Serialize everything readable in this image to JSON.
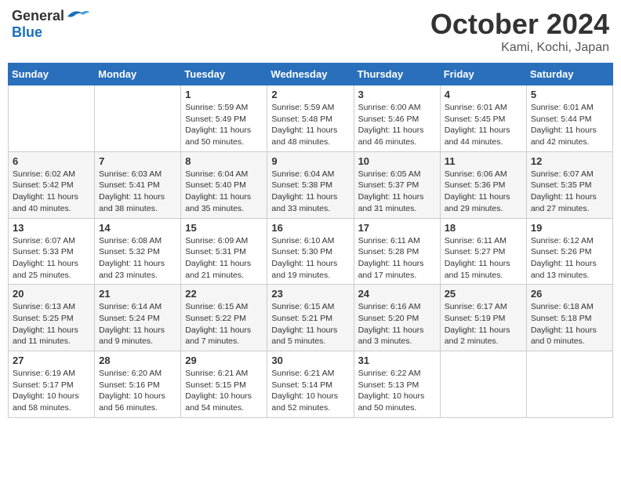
{
  "header": {
    "logo_general": "General",
    "logo_blue": "Blue",
    "month": "October 2024",
    "location": "Kami, Kochi, Japan"
  },
  "days_of_week": [
    "Sunday",
    "Monday",
    "Tuesday",
    "Wednesday",
    "Thursday",
    "Friday",
    "Saturday"
  ],
  "weeks": [
    [
      {
        "day": "",
        "info": ""
      },
      {
        "day": "",
        "info": ""
      },
      {
        "day": "1",
        "info": "Sunrise: 5:59 AM\nSunset: 5:49 PM\nDaylight: 11 hours and 50 minutes."
      },
      {
        "day": "2",
        "info": "Sunrise: 5:59 AM\nSunset: 5:48 PM\nDaylight: 11 hours and 48 minutes."
      },
      {
        "day": "3",
        "info": "Sunrise: 6:00 AM\nSunset: 5:46 PM\nDaylight: 11 hours and 46 minutes."
      },
      {
        "day": "4",
        "info": "Sunrise: 6:01 AM\nSunset: 5:45 PM\nDaylight: 11 hours and 44 minutes."
      },
      {
        "day": "5",
        "info": "Sunrise: 6:01 AM\nSunset: 5:44 PM\nDaylight: 11 hours and 42 minutes."
      }
    ],
    [
      {
        "day": "6",
        "info": "Sunrise: 6:02 AM\nSunset: 5:42 PM\nDaylight: 11 hours and 40 minutes."
      },
      {
        "day": "7",
        "info": "Sunrise: 6:03 AM\nSunset: 5:41 PM\nDaylight: 11 hours and 38 minutes."
      },
      {
        "day": "8",
        "info": "Sunrise: 6:04 AM\nSunset: 5:40 PM\nDaylight: 11 hours and 35 minutes."
      },
      {
        "day": "9",
        "info": "Sunrise: 6:04 AM\nSunset: 5:38 PM\nDaylight: 11 hours and 33 minutes."
      },
      {
        "day": "10",
        "info": "Sunrise: 6:05 AM\nSunset: 5:37 PM\nDaylight: 11 hours and 31 minutes."
      },
      {
        "day": "11",
        "info": "Sunrise: 6:06 AM\nSunset: 5:36 PM\nDaylight: 11 hours and 29 minutes."
      },
      {
        "day": "12",
        "info": "Sunrise: 6:07 AM\nSunset: 5:35 PM\nDaylight: 11 hours and 27 minutes."
      }
    ],
    [
      {
        "day": "13",
        "info": "Sunrise: 6:07 AM\nSunset: 5:33 PM\nDaylight: 11 hours and 25 minutes."
      },
      {
        "day": "14",
        "info": "Sunrise: 6:08 AM\nSunset: 5:32 PM\nDaylight: 11 hours and 23 minutes."
      },
      {
        "day": "15",
        "info": "Sunrise: 6:09 AM\nSunset: 5:31 PM\nDaylight: 11 hours and 21 minutes."
      },
      {
        "day": "16",
        "info": "Sunrise: 6:10 AM\nSunset: 5:30 PM\nDaylight: 11 hours and 19 minutes."
      },
      {
        "day": "17",
        "info": "Sunrise: 6:11 AM\nSunset: 5:28 PM\nDaylight: 11 hours and 17 minutes."
      },
      {
        "day": "18",
        "info": "Sunrise: 6:11 AM\nSunset: 5:27 PM\nDaylight: 11 hours and 15 minutes."
      },
      {
        "day": "19",
        "info": "Sunrise: 6:12 AM\nSunset: 5:26 PM\nDaylight: 11 hours and 13 minutes."
      }
    ],
    [
      {
        "day": "20",
        "info": "Sunrise: 6:13 AM\nSunset: 5:25 PM\nDaylight: 11 hours and 11 minutes."
      },
      {
        "day": "21",
        "info": "Sunrise: 6:14 AM\nSunset: 5:24 PM\nDaylight: 11 hours and 9 minutes."
      },
      {
        "day": "22",
        "info": "Sunrise: 6:15 AM\nSunset: 5:22 PM\nDaylight: 11 hours and 7 minutes."
      },
      {
        "day": "23",
        "info": "Sunrise: 6:15 AM\nSunset: 5:21 PM\nDaylight: 11 hours and 5 minutes."
      },
      {
        "day": "24",
        "info": "Sunrise: 6:16 AM\nSunset: 5:20 PM\nDaylight: 11 hours and 3 minutes."
      },
      {
        "day": "25",
        "info": "Sunrise: 6:17 AM\nSunset: 5:19 PM\nDaylight: 11 hours and 2 minutes."
      },
      {
        "day": "26",
        "info": "Sunrise: 6:18 AM\nSunset: 5:18 PM\nDaylight: 11 hours and 0 minutes."
      }
    ],
    [
      {
        "day": "27",
        "info": "Sunrise: 6:19 AM\nSunset: 5:17 PM\nDaylight: 10 hours and 58 minutes."
      },
      {
        "day": "28",
        "info": "Sunrise: 6:20 AM\nSunset: 5:16 PM\nDaylight: 10 hours and 56 minutes."
      },
      {
        "day": "29",
        "info": "Sunrise: 6:21 AM\nSunset: 5:15 PM\nDaylight: 10 hours and 54 minutes."
      },
      {
        "day": "30",
        "info": "Sunrise: 6:21 AM\nSunset: 5:14 PM\nDaylight: 10 hours and 52 minutes."
      },
      {
        "day": "31",
        "info": "Sunrise: 6:22 AM\nSunset: 5:13 PM\nDaylight: 10 hours and 50 minutes."
      },
      {
        "day": "",
        "info": ""
      },
      {
        "day": "",
        "info": ""
      }
    ]
  ]
}
